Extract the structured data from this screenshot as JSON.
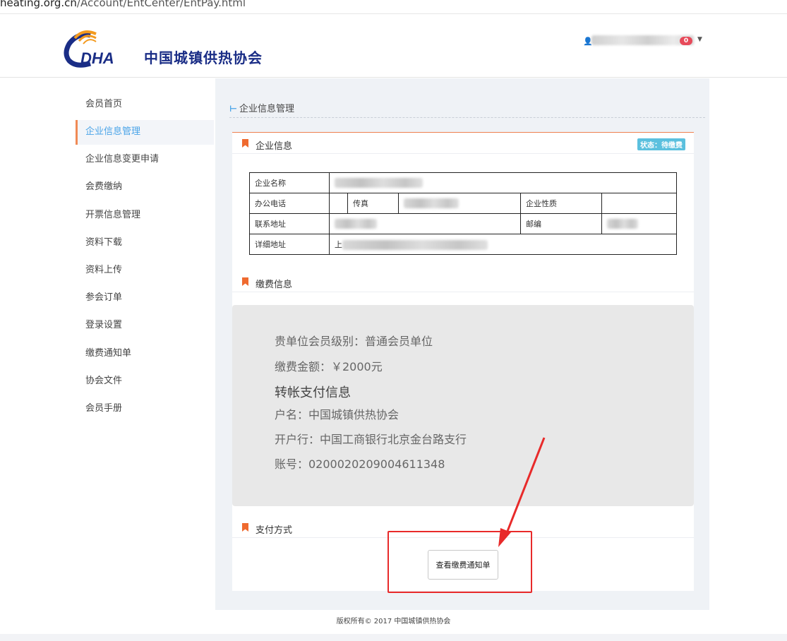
{
  "browser": {
    "url_prefix": "heating.org.cn",
    "url_path": "/Account/EntCenter/EntPay.html"
  },
  "header": {
    "logo_text": "DHA",
    "org_name": "中国城镇供热协会",
    "notification_count": "0",
    "brand_color": "#1a2d86",
    "accent_color": "#f08a55"
  },
  "sidebar": {
    "items": [
      {
        "label": "会员首页"
      },
      {
        "label": "企业信息管理"
      },
      {
        "label": "企业信息变更申请"
      },
      {
        "label": "会费缴纳"
      },
      {
        "label": "开票信息管理"
      },
      {
        "label": "资料下载"
      },
      {
        "label": "资料上传"
      },
      {
        "label": "参会订单"
      },
      {
        "label": "登录设置"
      },
      {
        "label": "缴费通知单"
      },
      {
        "label": "协会文件"
      },
      {
        "label": "会员手册"
      }
    ],
    "active_index": 1
  },
  "breadcrumb": {
    "label": "企业信息管理"
  },
  "company_section": {
    "title": "企业信息",
    "status_label": "状态：待缴费",
    "labels": {
      "name": "企业名称",
      "phone": "办公电话",
      "fax": "传真",
      "nature": "企业性质",
      "address": "联系地址",
      "postcode": "邮编",
      "detail_address": "详细地址"
    },
    "detail_address_visible_prefix": "上"
  },
  "payment_section": {
    "title": "缴费信息",
    "level_line": "贵单位会员级别：普通会员单位",
    "amount_line": "缴费金额：￥2000元",
    "transfer_heading": "转帐支付信息",
    "account_name_line": "户名：中国城镇供热协会",
    "bank_line": "开户行：中国工商银行北京金台路支行",
    "account_no_line": "账号：0200020209004611348"
  },
  "method_section": {
    "title": "支付方式",
    "view_notice_button": "查看缴费通知单"
  },
  "footer": {
    "text": "版权所有© 2017 中国城镇供热协会"
  }
}
